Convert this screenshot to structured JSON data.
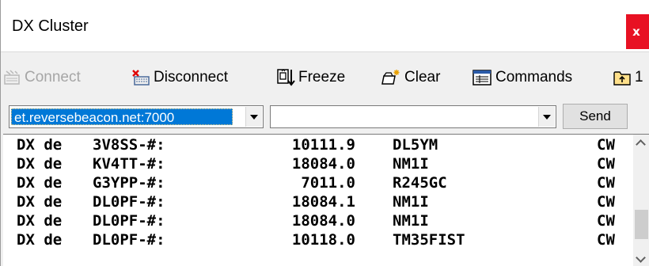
{
  "window": {
    "title": "DX Cluster",
    "close_glyph": "x"
  },
  "toolbar": {
    "connect_label": "Connect",
    "connect_enabled": false,
    "disconnect_label": "Disconnect",
    "freeze_label": "Freeze",
    "clear_label": "Clear",
    "commands_label": "Commands",
    "partial_label": "1"
  },
  "input": {
    "host_value": "et.reversebeacon.net:7000",
    "command_value": "",
    "send_label": "Send"
  },
  "spots": [
    {
      "prefix": "DX de",
      "spotter": "3V8SS-#:",
      "freq": "10111.9",
      "dx": "DL5YM",
      "mode": "CW"
    },
    {
      "prefix": "DX de",
      "spotter": "KV4TT-#:",
      "freq": "18084.0",
      "dx": "NM1I",
      "mode": "CW"
    },
    {
      "prefix": "DX de",
      "spotter": "G3YPP-#:",
      "freq": "7011.0",
      "dx": "R245GC",
      "mode": "CW"
    },
    {
      "prefix": "DX de",
      "spotter": "DL0PF-#:",
      "freq": "18084.1",
      "dx": "NM1I",
      "mode": "CW"
    },
    {
      "prefix": "DX de",
      "spotter": "DL0PF-#:",
      "freq": "18084.0",
      "dx": "NM1I",
      "mode": "CW"
    },
    {
      "prefix": "DX de",
      "spotter": "DL0PF-#:",
      "freq": "10118.0",
      "dx": "TM35FIST",
      "mode": "CW"
    }
  ],
  "colors": {
    "close": "#e81123",
    "selection": "#0078d7",
    "disabled_text": "#a6a6a6"
  }
}
